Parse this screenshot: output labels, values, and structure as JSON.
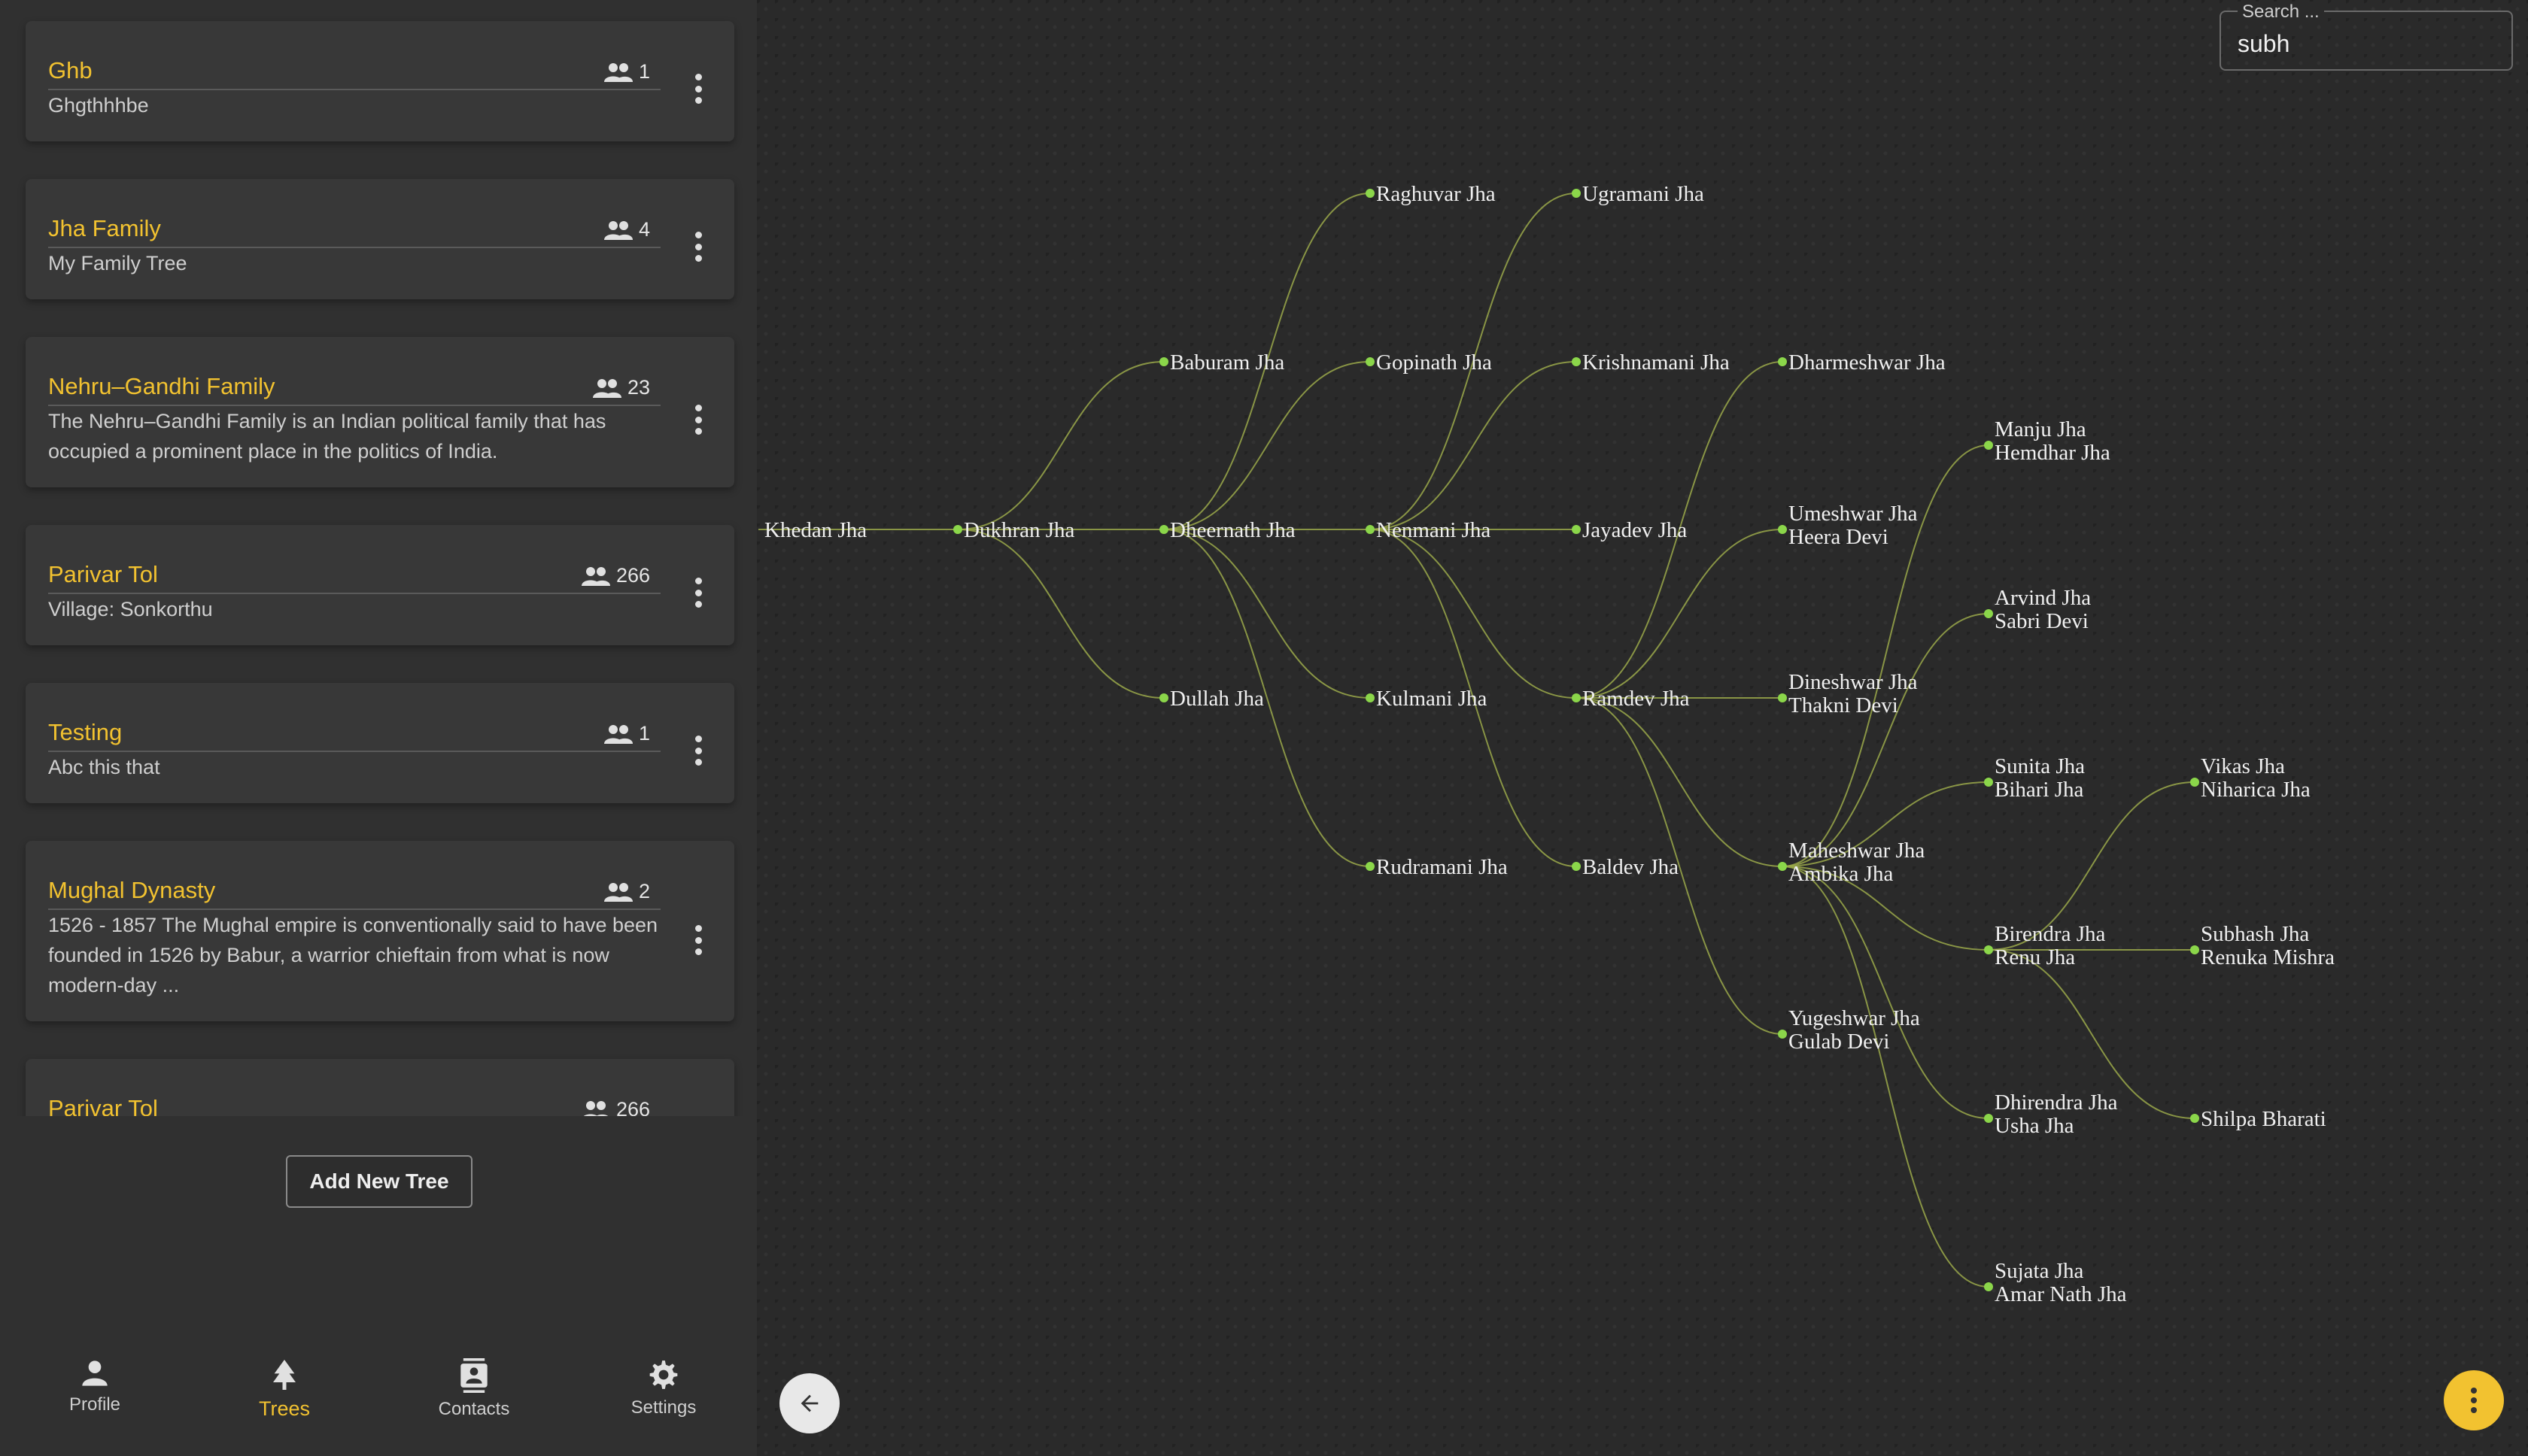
{
  "sidebar": {
    "trees": [
      {
        "title": "Ghb",
        "count": "1",
        "desc": "Ghgthhhbe"
      },
      {
        "title": "Jha Family",
        "count": "4",
        "desc": "My Family Tree"
      },
      {
        "title": "Nehru–Gandhi Family",
        "count": "23",
        "desc": "The Nehru–Gandhi Family is an Indian political family that has occupied a prominent place in the politics of India."
      },
      {
        "title": "Parivar Tol",
        "count": "266",
        "desc": "Village: Sonkorthu"
      },
      {
        "title": "Testing",
        "count": "1",
        "desc": "Abc this that"
      },
      {
        "title": "Mughal Dynasty",
        "count": "2",
        "desc": "1526 - 1857 The Mughal empire is conventionally said to have been founded in 1526 by Babur, a warrior chieftain from what is now modern-day ..."
      },
      {
        "title": "Parivar Tol",
        "count": "266",
        "desc": ""
      }
    ],
    "add_button": "Add New Tree"
  },
  "nav": {
    "profile": "Profile",
    "trees": "Trees",
    "contacts": "Contacts",
    "settings": "Settings",
    "active": "trees"
  },
  "search": {
    "label": "Search ...",
    "value": "subh"
  },
  "colors": {
    "accent": "#f2c230",
    "node": "#8bd64a",
    "edge": "#9aa84a"
  },
  "icons": {
    "members": "people-icon",
    "more": "more-vert-icon",
    "back": "arrow-left-icon",
    "fab": "more-vert-icon"
  },
  "family_tree": {
    "nodes": [
      {
        "id": "khedan",
        "lines": [
          "Khedan Jha"
        ]
      },
      {
        "id": "dukhran",
        "lines": [
          "Dukhran Jha"
        ]
      },
      {
        "id": "baburam",
        "lines": [
          "Baburam Jha"
        ]
      },
      {
        "id": "dheernath",
        "lines": [
          "Dheernath Jha"
        ]
      },
      {
        "id": "dullah",
        "lines": [
          "Dullah Jha"
        ]
      },
      {
        "id": "raghuvar",
        "lines": [
          "Raghuvar Jha"
        ]
      },
      {
        "id": "gopinath",
        "lines": [
          "Gopinath Jha"
        ]
      },
      {
        "id": "nenmani",
        "lines": [
          "Nenmani Jha"
        ]
      },
      {
        "id": "kulmani",
        "lines": [
          "Kulmani Jha"
        ]
      },
      {
        "id": "rudramani",
        "lines": [
          "Rudramani Jha"
        ]
      },
      {
        "id": "ugramani",
        "lines": [
          "Ugramani Jha"
        ]
      },
      {
        "id": "krishnamani",
        "lines": [
          "Krishnamani Jha"
        ]
      },
      {
        "id": "jayadev",
        "lines": [
          "Jayadev Jha"
        ]
      },
      {
        "id": "ramdev",
        "lines": [
          "Ramdev Jha"
        ]
      },
      {
        "id": "baldev",
        "lines": [
          "Baldev Jha"
        ]
      },
      {
        "id": "dharmeshwar",
        "lines": [
          "Dharmeshwar Jha"
        ]
      },
      {
        "id": "umeshwar",
        "lines": [
          "Umeshwar Jha",
          "Heera Devi"
        ]
      },
      {
        "id": "dineshwar",
        "lines": [
          "Dineshwar Jha",
          "Thakni Devi"
        ]
      },
      {
        "id": "maheshwar",
        "lines": [
          "Maheshwar Jha",
          "Ambika Jha"
        ]
      },
      {
        "id": "yugeshwar",
        "lines": [
          "Yugeshwar Jha",
          "Gulab Devi"
        ]
      },
      {
        "id": "manju",
        "lines": [
          "Manju Jha",
          "Hemdhar Jha"
        ]
      },
      {
        "id": "arvind",
        "lines": [
          "Arvind Jha",
          "Sabri Devi"
        ]
      },
      {
        "id": "sunita",
        "lines": [
          "Sunita Jha",
          "Bihari Jha"
        ]
      },
      {
        "id": "birendra",
        "lines": [
          "Birendra Jha",
          "Renu Jha"
        ]
      },
      {
        "id": "dhirendra",
        "lines": [
          "Dhirendra Jha",
          "Usha Jha"
        ]
      },
      {
        "id": "sujata",
        "lines": [
          "Sujata Jha",
          "Amar Nath Jha"
        ]
      },
      {
        "id": "vikas",
        "lines": [
          "Vikas Jha",
          "Niharica Jha"
        ]
      },
      {
        "id": "subhash",
        "lines": [
          "Subhash Jha",
          "Renuka Mishra"
        ]
      },
      {
        "id": "shilpa",
        "lines": [
          "Shilpa Bharati"
        ]
      }
    ],
    "edges": [
      [
        "khedan",
        "dukhran"
      ],
      [
        "dukhran",
        "baburam"
      ],
      [
        "dukhran",
        "dheernath"
      ],
      [
        "dukhran",
        "dullah"
      ],
      [
        "dheernath",
        "raghuvar"
      ],
      [
        "dheernath",
        "gopinath"
      ],
      [
        "dheernath",
        "nenmani"
      ],
      [
        "dheernath",
        "kulmani"
      ],
      [
        "dheernath",
        "rudramani"
      ],
      [
        "nenmani",
        "ugramani"
      ],
      [
        "nenmani",
        "krishnamani"
      ],
      [
        "nenmani",
        "jayadev"
      ],
      [
        "nenmani",
        "ramdev"
      ],
      [
        "nenmani",
        "baldev"
      ],
      [
        "ramdev",
        "dharmeshwar"
      ],
      [
        "ramdev",
        "umeshwar"
      ],
      [
        "ramdev",
        "dineshwar"
      ],
      [
        "ramdev",
        "maheshwar"
      ],
      [
        "ramdev",
        "yugeshwar"
      ],
      [
        "maheshwar",
        "manju"
      ],
      [
        "maheshwar",
        "arvind"
      ],
      [
        "maheshwar",
        "sunita"
      ],
      [
        "maheshwar",
        "birendra"
      ],
      [
        "maheshwar",
        "dhirendra"
      ],
      [
        "maheshwar",
        "sujata"
      ],
      [
        "birendra",
        "vikas"
      ],
      [
        "birendra",
        "subhash"
      ],
      [
        "birendra",
        "shilpa"
      ]
    ]
  }
}
